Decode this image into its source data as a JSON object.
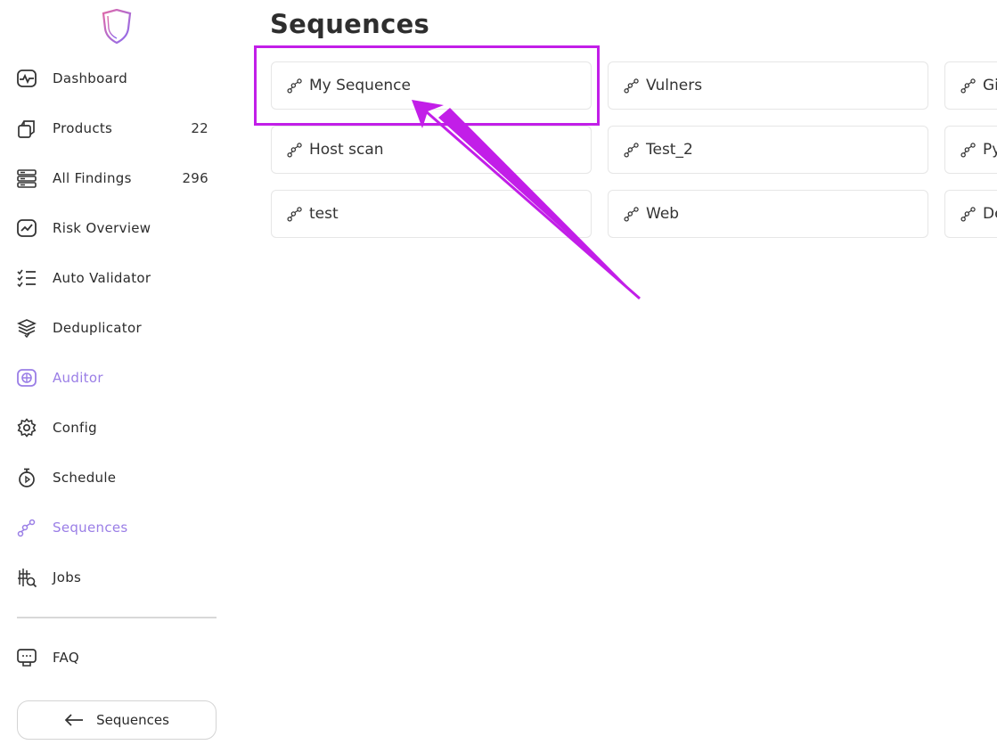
{
  "sidebar": {
    "items": [
      {
        "label": "Dashboard",
        "count": "",
        "icon": "dashboard-icon"
      },
      {
        "label": "Products",
        "count": "22",
        "icon": "products-icon"
      },
      {
        "label": "All Findings",
        "count": "296",
        "icon": "findings-icon"
      },
      {
        "label": "Risk Overview",
        "count": "",
        "icon": "risk-icon"
      },
      {
        "label": "Auto Validator",
        "count": "",
        "icon": "list-check-icon"
      },
      {
        "label": "Deduplicator",
        "count": "",
        "icon": "deduplicator-icon"
      },
      {
        "label": "Auditor",
        "count": "",
        "icon": "auditor-icon"
      },
      {
        "label": "Config",
        "count": "",
        "icon": "gear-icon"
      },
      {
        "label": "Schedule",
        "count": "",
        "icon": "timer-icon"
      },
      {
        "label": "Sequences",
        "count": "",
        "icon": "sequence-icon"
      },
      {
        "label": "Jobs",
        "count": "",
        "icon": "jobs-icon"
      }
    ],
    "faq_label": "FAQ",
    "back_button_label": "Sequences"
  },
  "main": {
    "title": "Sequences",
    "cards": [
      {
        "label": "My Sequence"
      },
      {
        "label": "Vulners"
      },
      {
        "label": "Gi"
      },
      {
        "label": "Host scan"
      },
      {
        "label": "Test_2"
      },
      {
        "label": "Py"
      },
      {
        "label": "test"
      },
      {
        "label": "Web"
      },
      {
        "label": "De"
      }
    ]
  },
  "colors": {
    "accent": "#9a7ee6",
    "annotation": "#c21ee8"
  }
}
